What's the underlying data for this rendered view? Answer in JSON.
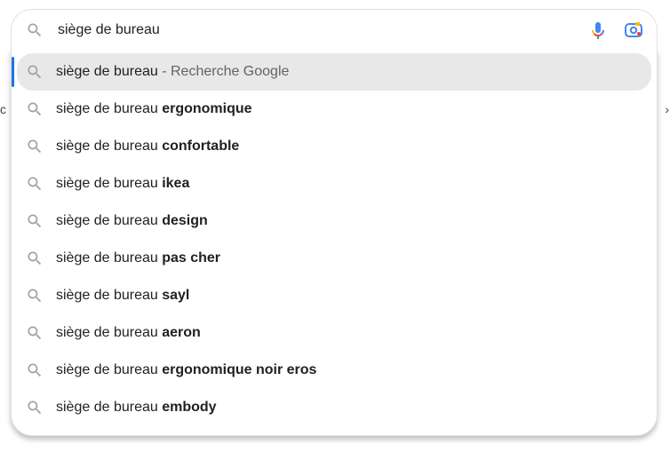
{
  "search": {
    "query": "siège de bureau"
  },
  "suffix_label": " - Recherche Google",
  "suggestions": [
    {
      "prefix": "siège de bureau",
      "bold": "",
      "suffix": " - Recherche Google",
      "selected": true
    },
    {
      "prefix": "siège de bureau ",
      "bold": "ergonomique",
      "suffix": "",
      "selected": false
    },
    {
      "prefix": "siège de bureau ",
      "bold": "confortable",
      "suffix": "",
      "selected": false
    },
    {
      "prefix": "siège de bureau ",
      "bold": "ikea",
      "suffix": "",
      "selected": false
    },
    {
      "prefix": "siège de bureau ",
      "bold": "design",
      "suffix": "",
      "selected": false
    },
    {
      "prefix": "siège de bureau ",
      "bold": "pas cher",
      "suffix": "",
      "selected": false
    },
    {
      "prefix": "siège de bureau ",
      "bold": "sayl",
      "suffix": "",
      "selected": false
    },
    {
      "prefix": "siège de bureau ",
      "bold": "aeron",
      "suffix": "",
      "selected": false
    },
    {
      "prefix": "siège de bureau ",
      "bold": "ergonomique noir eros",
      "suffix": "",
      "selected": false
    },
    {
      "prefix": "siège de bureau ",
      "bold": "embody",
      "suffix": "",
      "selected": false
    }
  ],
  "edge_left": "c",
  "edge_right": "›"
}
